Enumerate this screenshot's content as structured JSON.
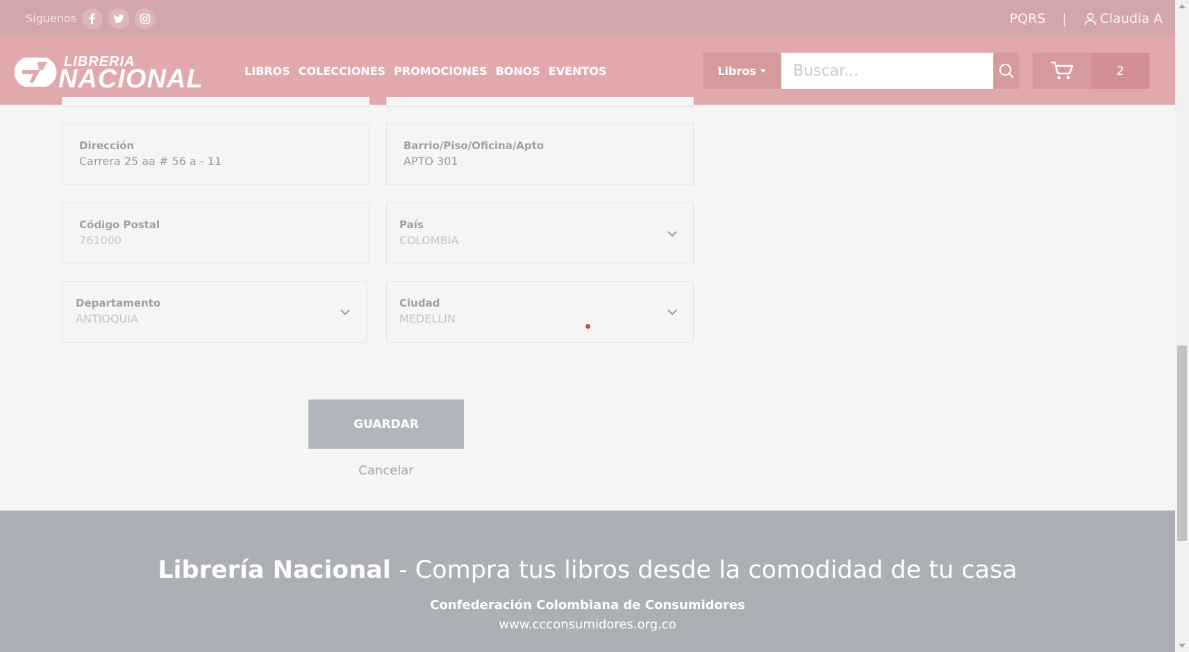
{
  "topbar": {
    "follow_label": "Síguenos",
    "social": [
      "facebook-icon",
      "twitter-icon",
      "instagram-icon"
    ],
    "pqrs": "PQRS",
    "separator": "|",
    "user_name": "Claudia A"
  },
  "header": {
    "logo_top": "LIBRERIA",
    "logo_main": "NACIONAL",
    "nav": [
      "LIBROS",
      "COLECCIONES",
      "PROMOCIONES",
      "BONOS",
      "EVENTOS"
    ],
    "category": "Libros",
    "search_placeholder": "Buscar...",
    "cart_count": "2"
  },
  "form": {
    "direccion": {
      "label": "Dirección",
      "value": "Carrera 25 aa # 56 a - 11"
    },
    "barrio": {
      "label": "Barrio/Piso/Oficina/Apto",
      "value": "APTO 301"
    },
    "codigo_postal": {
      "label": "Código Postal",
      "value": "761000"
    },
    "pais": {
      "label": "País",
      "value": "COLOMBIA"
    },
    "departamento": {
      "label": "Departamento",
      "value": "ANTIOQUIA"
    },
    "ciudad": {
      "label": "Ciudad",
      "value": "MEDELLIN"
    },
    "save_label": "GUARDAR",
    "cancel_label": "Cancelar"
  },
  "footer": {
    "brand": "Librería Nacional",
    "tagline": " - Compra tus libros desde la comodidad de tu casa",
    "org": "Confederación Colombiana de Consumidores",
    "url": "www.ccconsumidores.org.co"
  },
  "colors": {
    "topbar": "#d3a6a9",
    "header": "#e1a9ab",
    "footer": "#acafb6",
    "button": "#b1b5be"
  }
}
